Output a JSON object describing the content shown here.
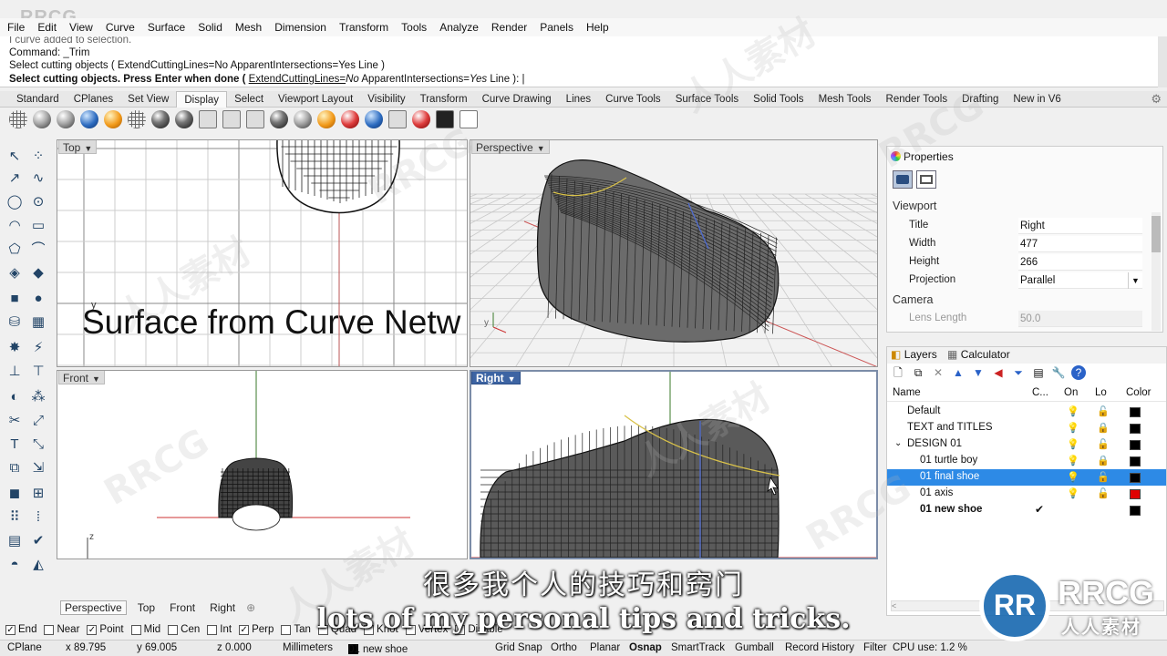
{
  "watermark": {
    "logo_text": "RRCG",
    "cn_text": "人人素材"
  },
  "menu": [
    "File",
    "Edit",
    "View",
    "Curve",
    "Surface",
    "Solid",
    "Mesh",
    "Dimension",
    "Transform",
    "Tools",
    "Analyze",
    "Render",
    "Panels",
    "Help"
  ],
  "command": {
    "line1": "I curve added to selection.",
    "line2": "Command: _Trim",
    "line3": "Select cutting objects ( ExtendCuttingLines=No  ApparentIntersections=Yes  Line )",
    "prompt_prefix": "Select cutting objects. Press Enter when done ( ",
    "prompt_opt1_key": "ExtendCuttingLines=",
    "prompt_opt1_val": "No",
    "prompt_opt2_key": "  ApparentIntersections=",
    "prompt_opt2_val": "Yes",
    "prompt_suffix": "  Line ): |"
  },
  "tabs": [
    "Standard",
    "CPlanes",
    "Set View",
    "Display",
    "Select",
    "Viewport Layout",
    "Visibility",
    "Transform",
    "Curve Drawing",
    "Lines",
    "Curve Tools",
    "Surface Tools",
    "Solid Tools",
    "Mesh Tools",
    "Render Tools",
    "Drafting",
    "New in V6"
  ],
  "active_tab": "Display",
  "viewports": {
    "top": "Top",
    "perspective": "Perspective",
    "front": "Front",
    "right": "Right",
    "big_title": "Surface from Curve Netw",
    "axis_y": "y",
    "axis_x": "x",
    "axis_z": "z"
  },
  "viewport_tabs": [
    "Perspective",
    "Top",
    "Front",
    "Right"
  ],
  "properties": {
    "title": "Properties",
    "section_viewport": "Viewport",
    "rows": [
      {
        "key": "Title",
        "value": "Right"
      },
      {
        "key": "Width",
        "value": "477"
      },
      {
        "key": "Height",
        "value": "266"
      },
      {
        "key": "Projection",
        "value": "Parallel"
      }
    ],
    "section_camera": "Camera",
    "lens_key": "Lens Length",
    "lens_value": "50.0"
  },
  "layers_panel": {
    "tab_layers": "Layers",
    "tab_calculator": "Calculator",
    "col_name": "Name",
    "col_current": "C...",
    "col_on": "On",
    "col_lock": "Lo",
    "col_color": "Color",
    "rows": [
      {
        "name": "Default",
        "color": "#000000"
      },
      {
        "name": "TEXT and TITLES",
        "color": "#000000"
      },
      {
        "name": "DESIGN 01",
        "color": "#000000"
      },
      {
        "name": "01 turtle boy",
        "color": "#000000"
      },
      {
        "name": "01 final shoe",
        "color": "#000000"
      },
      {
        "name": "01 axis",
        "color": "#e00000"
      },
      {
        "name": "01 new shoe",
        "color": "#000000"
      }
    ]
  },
  "osnaps": [
    {
      "label": "End",
      "checked": true
    },
    {
      "label": "Near",
      "checked": false
    },
    {
      "label": "Point",
      "checked": true
    },
    {
      "label": "Mid",
      "checked": false
    },
    {
      "label": "Cen",
      "checked": false
    },
    {
      "label": "Int",
      "checked": false
    },
    {
      "label": "Perp",
      "checked": true
    },
    {
      "label": "Tan",
      "checked": false
    },
    {
      "label": "Quad",
      "checked": false
    },
    {
      "label": "Knot",
      "checked": false
    },
    {
      "label": "Vertex",
      "checked": false
    },
    {
      "label": "Disable",
      "checked": false
    }
  ],
  "status": {
    "cplane": "CPlane",
    "x": "x 89.795",
    "y": "y 69.005",
    "z": "z 0.000",
    "units": "Millimeters",
    "layer": "01 new shoe",
    "grid_snap": "Grid Snap",
    "ortho": "Ortho",
    "planar": "Planar",
    "osnap": "Osnap",
    "smarttrack": "SmartTrack",
    "gumball": "Gumball",
    "record_history": "Record History",
    "filter": "Filter",
    "cpu": "CPU use: 1.2 %"
  },
  "subtitles": {
    "cn": "很多我个人的技巧和窍门",
    "en": "lots of my personal tips and tricks."
  },
  "logo": {
    "mark": "RR",
    "name": "RRCG",
    "cn": "人人素材"
  }
}
